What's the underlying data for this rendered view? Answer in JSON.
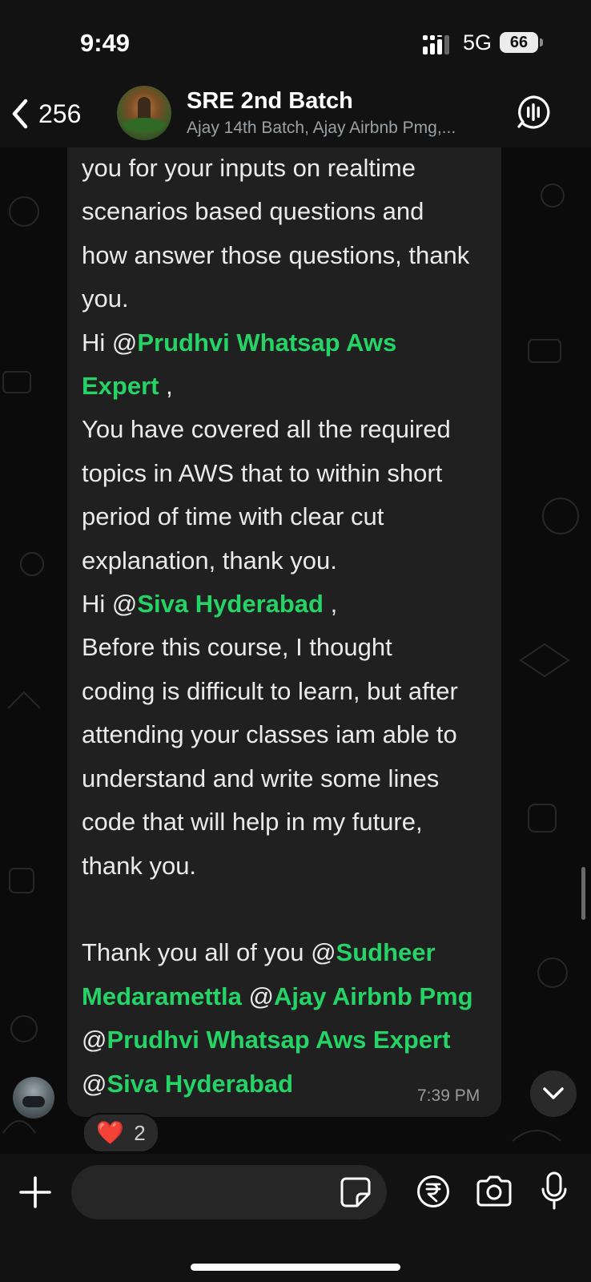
{
  "status_bar": {
    "time": "9:49",
    "network": "5G",
    "battery": "66"
  },
  "header": {
    "back_count": "256",
    "title": "SRE 2nd Batch",
    "subtitle": "Ajay 14th Batch, Ajay Airbnb Pmg,..."
  },
  "message": {
    "lines": [
      [
        {
          "t": "you for your inputs on realtime"
        }
      ],
      [
        {
          "t": "scenarios based questions and"
        }
      ],
      [
        {
          "t": "how answer those questions, thank"
        }
      ],
      [
        {
          "t": "you."
        }
      ],
      [
        {
          "t": "Hi "
        },
        {
          "t": "@"
        },
        {
          "t": "Prudhvi Whatsap Aws",
          "m": true
        }
      ],
      [
        {
          "t": "Expert",
          "m": true
        },
        {
          "t": " ,"
        }
      ],
      [
        {
          "t": "You have covered all the required"
        }
      ],
      [
        {
          "t": "topics in AWS that to within short"
        }
      ],
      [
        {
          "t": "period of time with clear cut"
        }
      ],
      [
        {
          "t": "explanation, thank you."
        }
      ],
      [
        {
          "t": "Hi "
        },
        {
          "t": "@"
        },
        {
          "t": "Siva Hyderabad",
          "m": true
        },
        {
          "t": " ,"
        }
      ],
      [
        {
          "t": "Before this course, I thought"
        }
      ],
      [
        {
          "t": "coding is difficult to learn, but after"
        }
      ],
      [
        {
          "t": "attending your classes iam able to"
        }
      ],
      [
        {
          "t": "understand and write some lines"
        }
      ],
      [
        {
          "t": "code that will help in my future,"
        }
      ],
      [
        {
          "t": "thank you."
        }
      ],
      [],
      [
        {
          "t": "Thank you all of you "
        },
        {
          "t": "@"
        },
        {
          "t": "Sudheer",
          "m": true
        }
      ],
      [
        {
          "t": "Medaramettla",
          "m": true
        },
        {
          "t": " @"
        },
        {
          "t": "Ajay Airbnb Pmg",
          "m": true
        }
      ],
      [
        {
          "t": "@"
        },
        {
          "t": "Prudhvi Whatsap Aws Expert",
          "m": true
        }
      ],
      [
        {
          "t": "@"
        },
        {
          "t": "Siva Hyderabad",
          "m": true
        }
      ]
    ],
    "timestamp": "7:39 PM",
    "reaction_emoji": "❤️",
    "reaction_count": "2"
  },
  "composer": {
    "placeholder": "",
    "icons": [
      "plus-icon",
      "sticker-icon",
      "rupee-icon",
      "camera-icon",
      "mic-icon"
    ]
  },
  "colors": {
    "mention": "#25d366",
    "bubble": "#202020",
    "background": "#0b0b0b"
  }
}
